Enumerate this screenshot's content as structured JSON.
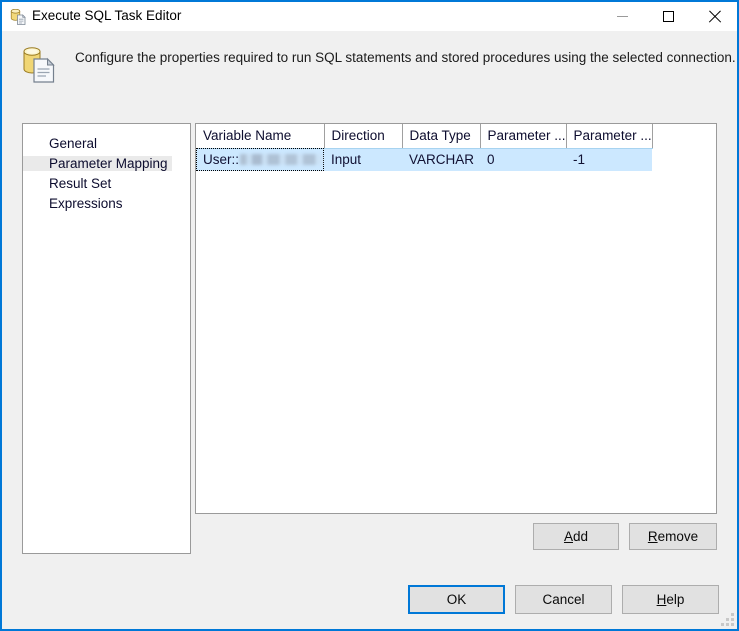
{
  "window": {
    "title": "Execute SQL Task Editor",
    "title_icon": "sql-task-icon",
    "accent_color": "#0078d7",
    "body_color": "#f0f0f0",
    "controls": {
      "minimize": "minimize-icon",
      "maximize": "maximize-icon",
      "close": "close-icon"
    }
  },
  "header": {
    "icon": "sql-database-script-icon",
    "description": "Configure the properties required to run SQL statements and stored procedures using the selected connection."
  },
  "sidebar": {
    "selected": "Parameter Mapping",
    "items": [
      {
        "label": "General"
      },
      {
        "label": "Parameter Mapping"
      },
      {
        "label": "Result Set"
      },
      {
        "label": "Expressions"
      }
    ]
  },
  "grid": {
    "columns": [
      {
        "label": "Variable Name",
        "width": 119
      },
      {
        "label": "Direction",
        "width": 78
      },
      {
        "label": "Data Type",
        "width": 78
      },
      {
        "label": "Parameter ...",
        "width": 80
      },
      {
        "label": "Parameter ...",
        "width": 79
      }
    ],
    "rows": [
      {
        "selected": true,
        "variable_name_prefix": "User::",
        "variable_name_redacted": true,
        "direction": "Input",
        "data_type": "VARCHAR",
        "parameter_4": "0",
        "parameter_5": "-1"
      }
    ],
    "selection_color": "#cce8ff"
  },
  "buttons": {
    "add": {
      "label": "Add",
      "accel": "A"
    },
    "remove": {
      "label": "Remove",
      "accel": "R"
    },
    "ok": {
      "label": "OK",
      "default": true
    },
    "cancel": {
      "label": "Cancel"
    },
    "help": {
      "label": "Help",
      "accel": "H"
    }
  }
}
